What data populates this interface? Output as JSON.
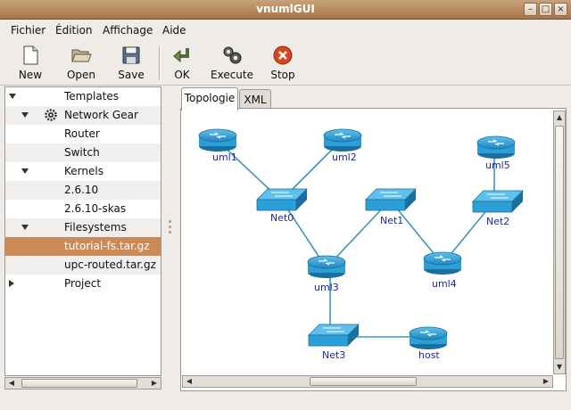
{
  "window": {
    "title": "vnumlGUI"
  },
  "menu": [
    "Fichier",
    "Édition",
    "Affichage",
    "Aide"
  ],
  "toolbar": {
    "new": "New",
    "open": "Open",
    "save": "Save",
    "ok": "OK",
    "execute": "Execute",
    "stop": "Stop"
  },
  "tree": {
    "templates": "Templates",
    "network_gear": "Network Gear",
    "router": "Router",
    "switch": "Switch",
    "kernels": "Kernels",
    "kernel_1": "2.6.10",
    "kernel_2": "2.6.10-skas",
    "filesystems": "Filesystems",
    "fs_1": "tutorial-fs.tar.gz",
    "fs_2": "upc-routed.tar.gz",
    "project": "Project"
  },
  "tabs": {
    "topology": "Topologie",
    "xml": "XML"
  },
  "topology": {
    "uml1": "uml1",
    "uml2": "uml2",
    "uml3": "uml3",
    "uml4": "uml4",
    "uml5": "uml5",
    "net0": "Net0",
    "net1": "Net1",
    "net2": "Net2",
    "net3": "Net3",
    "host": "host"
  },
  "colors": {
    "device": "#2b9fd6",
    "link": "#3c95c4",
    "selection": "#cc8a56",
    "titlebar": "#b7875d"
  }
}
